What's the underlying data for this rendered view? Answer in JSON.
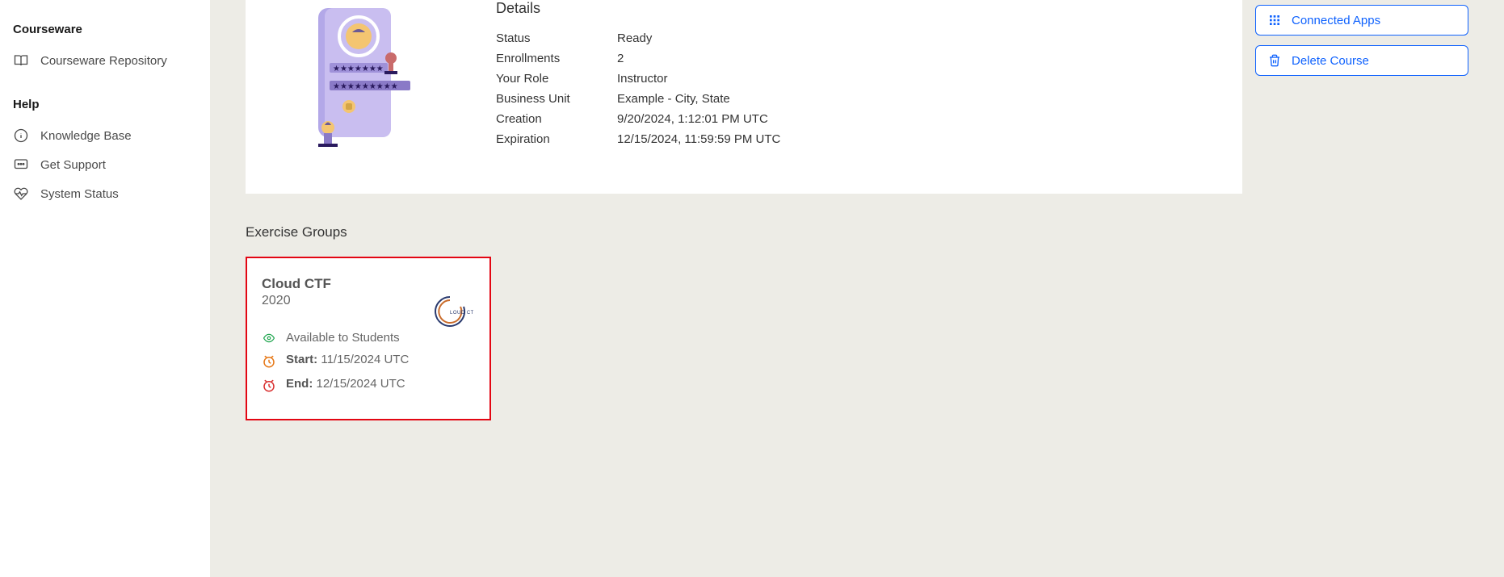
{
  "sidebar": {
    "courseware_section": "Courseware",
    "help_section": "Help",
    "items": {
      "courseware_repository": "Courseware Repository",
      "knowledge_base": "Knowledge Base",
      "get_support": "Get Support",
      "system_status": "System Status"
    }
  },
  "details": {
    "heading": "Details",
    "rows": {
      "status_label": "Status",
      "status_value": "Ready",
      "enrollments_label": "Enrollments",
      "enrollments_value": "2",
      "role_label": "Your Role",
      "role_value": "Instructor",
      "bu_label": "Business Unit",
      "bu_value": "Example - City, State",
      "creation_label": "Creation",
      "creation_value": "9/20/2024, 1:12:01 PM UTC",
      "expiration_label": "Expiration",
      "expiration_value": "12/15/2024, 11:59:59 PM UTC"
    }
  },
  "actions": {
    "connected_apps": "Connected Apps",
    "delete_course": "Delete Course"
  },
  "exercise_groups": {
    "heading": "Exercise Groups",
    "card": {
      "title": "Cloud CTF",
      "subtitle": "2020",
      "available_label": "Available to Students",
      "start_label": "Start:",
      "start_value": "11/15/2024 UTC",
      "end_label": "End:",
      "end_value": "12/15/2024 UTC",
      "logo_text": "CLOUD CTF"
    }
  }
}
